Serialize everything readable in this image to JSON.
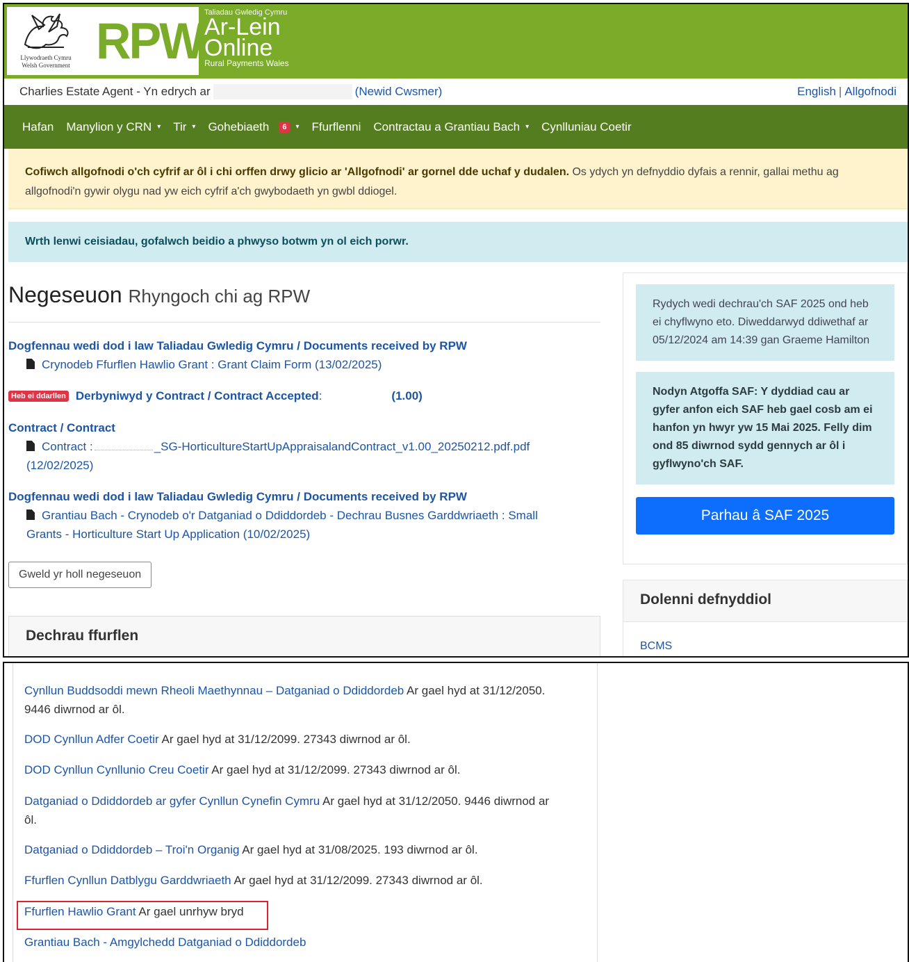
{
  "header": {
    "gov_line1": "Llywodraeth Cymru",
    "gov_line2": "Welsh Government",
    "brand": "RPW",
    "online_top": "Taliadau Gwledig Cymru",
    "online_cy": "Ar-Lein",
    "online_en": "Online",
    "online_bottom": "Rural Payments Wales"
  },
  "user_bar": {
    "viewing_as": "Charlies Estate Agent - Yn edrych ar",
    "change_customer": "(Newid Cwsmer)",
    "english": "English",
    "separator": "|",
    "logout": "Allgofnodi"
  },
  "nav": {
    "home": "Hafan",
    "crn": "Manylion y CRN",
    "land": "Tir",
    "correspondence": "Gohebiaeth",
    "correspondence_count": "6",
    "forms": "Ffurflenni",
    "contracts": "Contractau a Grantiau Bach",
    "woodland": "Cynlluniau Coetir",
    "caret": "▾"
  },
  "alerts": {
    "logout_bold": "Cofiwch allgofnodi o'ch cyfrif ar ôl i chi orffen drwy glicio ar 'Allgofnodi' ar gornel dde uchaf y dudalen.",
    "logout_rest": "Os ydych yn defnyddio dyfais a rennir, gallai methu ag allgofnodi'n gywir olygu nad yw eich cyfrif a'ch gwybodaeth yn gwbl ddiogel.",
    "back_button": "Wrth lenwi ceisiadau, gofalwch beidio a phwyso botwm yn ol eich porwr."
  },
  "messages": {
    "title": "Negeseuon",
    "subtitle": "Rhyngoch chi ag RPW",
    "items": [
      {
        "heading": "Dogfennau wedi dod i law Taliadau Gwledig Cymru / Documents received by RPW",
        "doc": "Crynodeb Ffurflen Hawlio Grant : Grant Claim Form (13/02/2025)"
      },
      {
        "unread": "Heb ei ddarllen",
        "heading": "Derbyniwyd y Contract / Contract Accepted",
        "colon": ":",
        "version": "(1.00)"
      },
      {
        "heading": "Contract / Contract",
        "doc_prefix": "Contract :",
        "doc_file": "_SG-HorticultureStartUpAppraisalandContract_v1.00_20250212.pdf.pdf",
        "doc_date": "(12/02/2025)"
      },
      {
        "heading": "Dogfennau wedi dod i law Taliadau Gwledig Cymru / Documents received by RPW",
        "doc_line1": "Grantiau Bach - Crynodeb o'r Datganiad o Ddiddordeb - Dechrau Busnes Garddwriaeth : Small",
        "doc_line2": "Grants - Horticulture Start Up Application (10/02/2025)"
      }
    ],
    "view_all": "Gweld yr holl negeseuon"
  },
  "start_form": {
    "title": "Dechrau ffurflen"
  },
  "sidebar": {
    "saf_status": "Rydych wedi dechrau'ch SAF 2025 ond heb ei chyflwyno eto. Diweddarwyd ddiwethaf ar 05/12/2024 am 14:39 gan Graeme Hamilton",
    "saf_reminder": "Nodyn Atgoffa SAF: Y dyddiad cau ar gyfer anfon eich SAF heb gael cosb am ei hanfon yn hwyr yw 15 Mai 2025. Felly dim ond 85 diwrnod sydd gennych ar ôl i gyflwyno'ch SAF.",
    "continue_button": "Parhau â SAF 2025",
    "useful_links_title": "Dolenni defnyddiol",
    "bcms": "BCMS"
  },
  "forms_list": [
    {
      "link": "Cynllun Buddsoddi mewn Rheoli Maethynnau – Datganiad o Ddiddordeb",
      "avail_1": "Ar gael hyd at 31/12/2050.",
      "avail_2": "9446 diwrnod ar ôl."
    },
    {
      "link": "DOD Cynllun Adfer Coetir",
      "avail": "Ar gael hyd at 31/12/2099. 27343 diwrnod ar ôl."
    },
    {
      "link": "DOD Cynllun Cynllunio Creu Coetir",
      "avail": "Ar gael hyd at 31/12/2099. 27343 diwrnod ar ôl."
    },
    {
      "link": "Datganiad o Ddiddordeb ar gyfer Cynllun Cynefin Cymru",
      "avail_1": "Ar gael hyd at 31/12/2050. 9446 diwrnod ar",
      "avail_2": "ôl."
    },
    {
      "link": "Datganiad o Ddiddordeb – Troi'n Organig",
      "avail": "Ar gael hyd at 31/08/2025. 193 diwrnod ar ôl."
    },
    {
      "link": "Ffurflen Cynllun Datblygu Garddwriaeth",
      "avail": "Ar gael hyd at 31/12/2099. 27343 diwrnod ar ôl."
    },
    {
      "link": "Ffurflen Hawlio Grant",
      "avail": "Ar gael unrhyw bryd"
    },
    {
      "link": "Grantiau Bach - Amgylchedd Datganiad o Ddiddordeb"
    }
  ],
  "colors": {
    "brand_green": "#7aac2a",
    "nav_green": "#537d1f",
    "link_blue": "#1c55a6",
    "primary": "#0d6efd",
    "highlight_red": "#d9252c"
  }
}
